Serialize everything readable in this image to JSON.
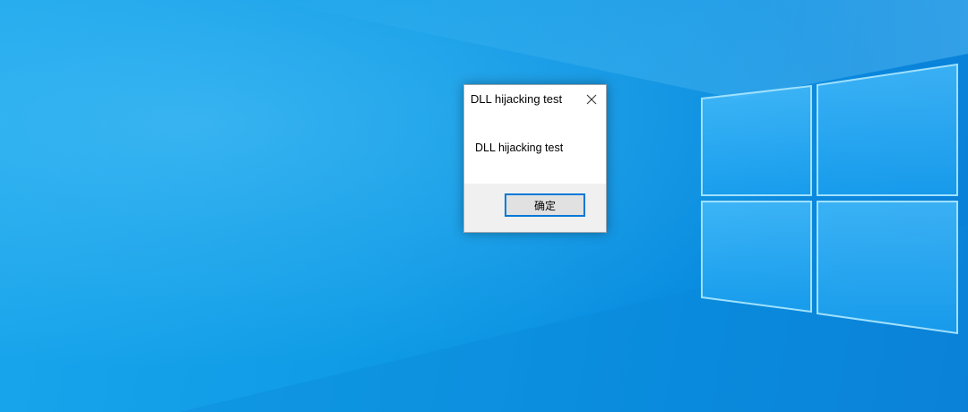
{
  "desktop": {
    "background_color": "#0f9be6",
    "logo": "windows-logo"
  },
  "dialog": {
    "title": "DLL hijacking test",
    "message": "DLL hijacking test",
    "close_icon": "close-icon",
    "ok_button_label": "确定",
    "accent_color": "#0078d7"
  }
}
